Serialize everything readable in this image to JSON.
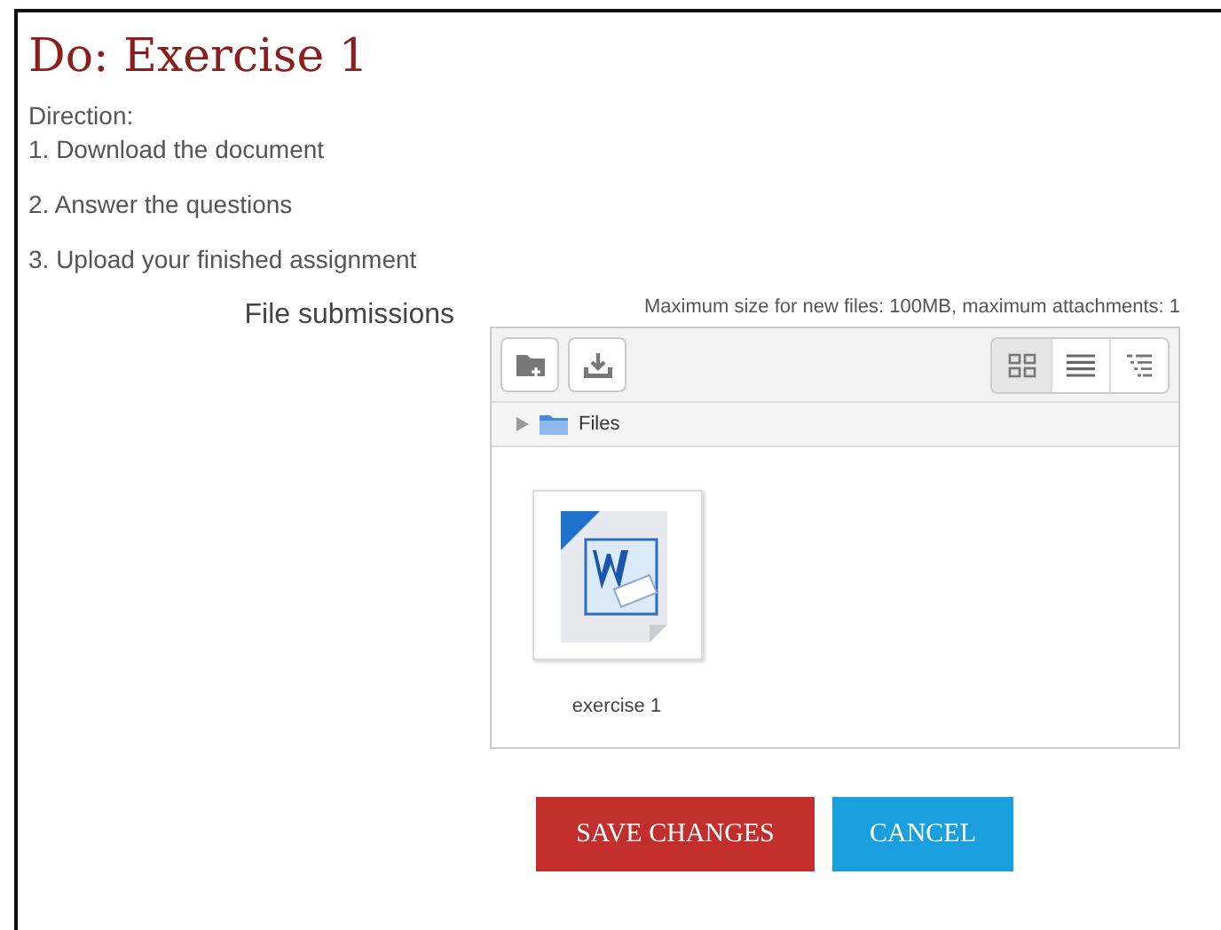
{
  "heading": "Do: Exercise 1",
  "directions": [
    "Direction:",
    "1. Download the document",
    "2. Answer the questions",
    "3. Upload your finished assignment"
  ],
  "field_label": "File submissions",
  "limits": "Maximum size for new files: 100MB, maximum attachments: 1",
  "views": [
    {
      "kind": "icons",
      "selected": true
    },
    {
      "kind": "list",
      "selected": false
    },
    {
      "kind": "tree",
      "selected": false
    }
  ],
  "path": {
    "label": "Files"
  },
  "files": [
    {
      "name": "exercise 1",
      "kind": "word"
    }
  ],
  "buttons": [
    {
      "label": "SAVE CHANGES",
      "kind": "primary"
    },
    {
      "label": "CANCEL",
      "kind": "secondary"
    }
  ]
}
